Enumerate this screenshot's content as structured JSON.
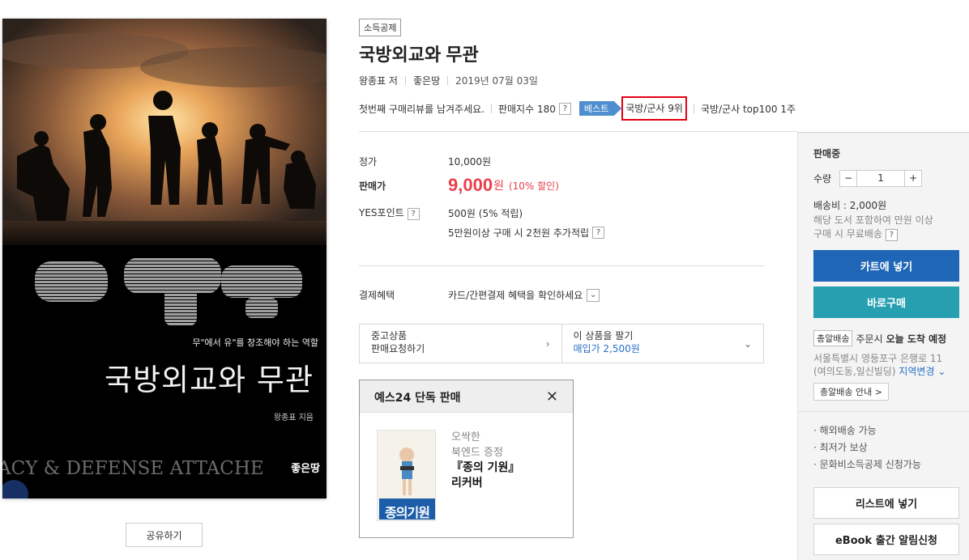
{
  "cover": {
    "tagline": "무\"에서 유\"를 창조해야 하는 역할",
    "title": "국방외교와 무관",
    "author": "왕종표 지음",
    "english": "ACY & DEFENSE ATTACHE",
    "publisher_logo": "좋은땅"
  },
  "share_label": "공유하기",
  "product": {
    "badge": "소득공제",
    "title": "국방외교와 무관",
    "author": "왕종표 저",
    "publisher": "좋은땅",
    "date": "2019년 07월 03일",
    "review_prompt": "첫번째 구매리뷰를 남겨주세요.",
    "sales_index": "판매지수 180",
    "best_label": "베스트",
    "rank": "국방/군사 9위",
    "top100": "국방/군사 top100 1주"
  },
  "pricing": {
    "list_label": "정가",
    "list_price": "10,000원",
    "sale_label": "판매가",
    "sale_price": "9,000",
    "sale_unit": "원",
    "discount": "(10% 할인)",
    "point_label": "YES포인트",
    "point_value": "500원 (5% 적립)",
    "point_extra": "5만원이상 구매 시 2천원 추가적립",
    "payment_label": "결제혜택",
    "payment_value": "카드/간편결제 혜택을 확인하세요"
  },
  "used": {
    "left_line1": "중고상품",
    "left_line2": "판매요청하기",
    "right_line1": "이 상품을 팔기",
    "right_line2": "매입가 2,500원"
  },
  "exclusive": {
    "header": "예스24 단독 판매",
    "line1": "오싹한",
    "line2": "북엔드 증정",
    "line3": "『종의 기원』",
    "line4": "리커버",
    "thumb_title": "종의기원"
  },
  "panel": {
    "status": "판매중",
    "qty_label": "수량",
    "qty_minus": "−",
    "qty_value": "1",
    "qty_plus": "+",
    "shipping": "배송비 : 2,000원",
    "free_ship_1": "해당 도서 포함하여 만원 이상",
    "free_ship_2": "구매 시 무료배송",
    "cart_btn": "카트에 넣기",
    "buy_btn": "바로구매",
    "tomorrow_tag": "총알배송",
    "delivery_text": "주문시",
    "delivery_bold": "오늘 도착 예정",
    "address_1": "서울특별시 영등포구 은행로 11",
    "address_2": "(여의도동,일신빌딩)",
    "address_change": "지역변경",
    "tomorrow_info_btn": "총알배송 안내 >",
    "bullets": [
      "· 해외배송 가능",
      "· 최저가 보상",
      "· 문화비소득공제 신청가능"
    ],
    "list_btn": "리스트에 넣기",
    "ebook_btn": "eBook 출간 알림신청",
    "colors": {
      "cart": "#1f66b7",
      "buy": "#26a0b1"
    }
  }
}
